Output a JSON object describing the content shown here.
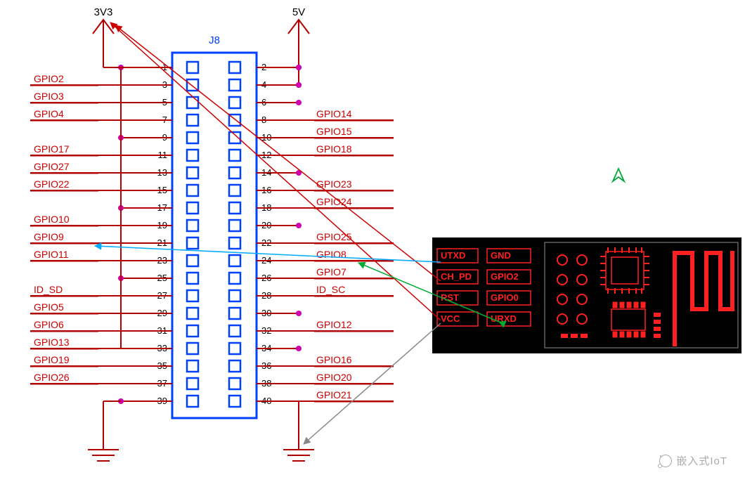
{
  "connector": {
    "ref": "J8",
    "total_pins": 40,
    "power": {
      "left": "3V3",
      "right": "5V"
    }
  },
  "left_pins": [
    {
      "num": 1,
      "label": ""
    },
    {
      "num": 3,
      "label": "GPIO2"
    },
    {
      "num": 5,
      "label": "GPIO3"
    },
    {
      "num": 7,
      "label": "GPIO4"
    },
    {
      "num": 9,
      "label": ""
    },
    {
      "num": 11,
      "label": "GPIO17"
    },
    {
      "num": 13,
      "label": "GPIO27"
    },
    {
      "num": 15,
      "label": "GPIO22"
    },
    {
      "num": 17,
      "label": ""
    },
    {
      "num": 19,
      "label": "GPIO10"
    },
    {
      "num": 21,
      "label": "GPIO9"
    },
    {
      "num": 23,
      "label": "GPIO11"
    },
    {
      "num": 25,
      "label": ""
    },
    {
      "num": 27,
      "label": "ID_SD"
    },
    {
      "num": 29,
      "label": "GPIO5"
    },
    {
      "num": 31,
      "label": "GPIO6"
    },
    {
      "num": 33,
      "label": "GPIO13"
    },
    {
      "num": 35,
      "label": "GPIO19"
    },
    {
      "num": 37,
      "label": "GPIO26"
    },
    {
      "num": 39,
      "label": ""
    }
  ],
  "right_pins": [
    {
      "num": 2,
      "label": ""
    },
    {
      "num": 4,
      "label": ""
    },
    {
      "num": 6,
      "label": ""
    },
    {
      "num": 8,
      "label": "GPIO14"
    },
    {
      "num": 10,
      "label": "GPIO15"
    },
    {
      "num": 12,
      "label": "GPIO18"
    },
    {
      "num": 14,
      "label": ""
    },
    {
      "num": 16,
      "label": "GPIO23"
    },
    {
      "num": 18,
      "label": "GPIO24"
    },
    {
      "num": 20,
      "label": ""
    },
    {
      "num": 22,
      "label": "GPIO25"
    },
    {
      "num": 24,
      "label": "GPIO8"
    },
    {
      "num": 26,
      "label": "GPIO7"
    },
    {
      "num": 28,
      "label": "ID_SC"
    },
    {
      "num": 30,
      "label": ""
    },
    {
      "num": 32,
      "label": "GPIO12"
    },
    {
      "num": 34,
      "label": ""
    },
    {
      "num": 36,
      "label": "GPIO16"
    },
    {
      "num": 38,
      "label": "GPIO20"
    },
    {
      "num": 40,
      "label": "GPIO21"
    }
  ],
  "esp_module": {
    "pins_left_col": [
      {
        "name": "UTXD"
      },
      {
        "name": "CH_PD"
      },
      {
        "name": "RST"
      },
      {
        "name": "VCC"
      }
    ],
    "pins_right_col": [
      {
        "name": "GND"
      },
      {
        "name": "GPIO2"
      },
      {
        "name": "GPIO0"
      },
      {
        "name": "URXD"
      }
    ]
  },
  "chart_data": {
    "type": "diagram",
    "description": "Raspberry Pi 40-pin GPIO header (J8) schematic wired to an ESP8266 ESP-01 module",
    "connections": [
      {
        "from": "ESP.VCC",
        "to": "J8.pin1 (3V3)",
        "style": "red-arrow"
      },
      {
        "from": "ESP.CH_PD",
        "to": "J8.pin1 (3V3)",
        "style": "red-arrow"
      },
      {
        "from": "ESP.UTXD",
        "to": "J8.pin21 (GPIO9)",
        "style": "cyan-arrow"
      },
      {
        "from": "ESP.URXD",
        "to": "J8.pin24 (GPIO8)",
        "style": "green-arrow"
      },
      {
        "from": "ESP.GND",
        "to": "J8 GND (bottom right ground)",
        "style": "gray-arrow"
      }
    ],
    "power_rails": {
      "3V3": [
        1,
        17
      ],
      "5V": [
        2,
        4
      ],
      "GND": [
        6,
        9,
        14,
        20,
        25,
        30,
        34,
        39
      ]
    },
    "compass_marker": "▲ (north indicator, upper-right area)"
  },
  "watermark": "嵌入式IoT"
}
